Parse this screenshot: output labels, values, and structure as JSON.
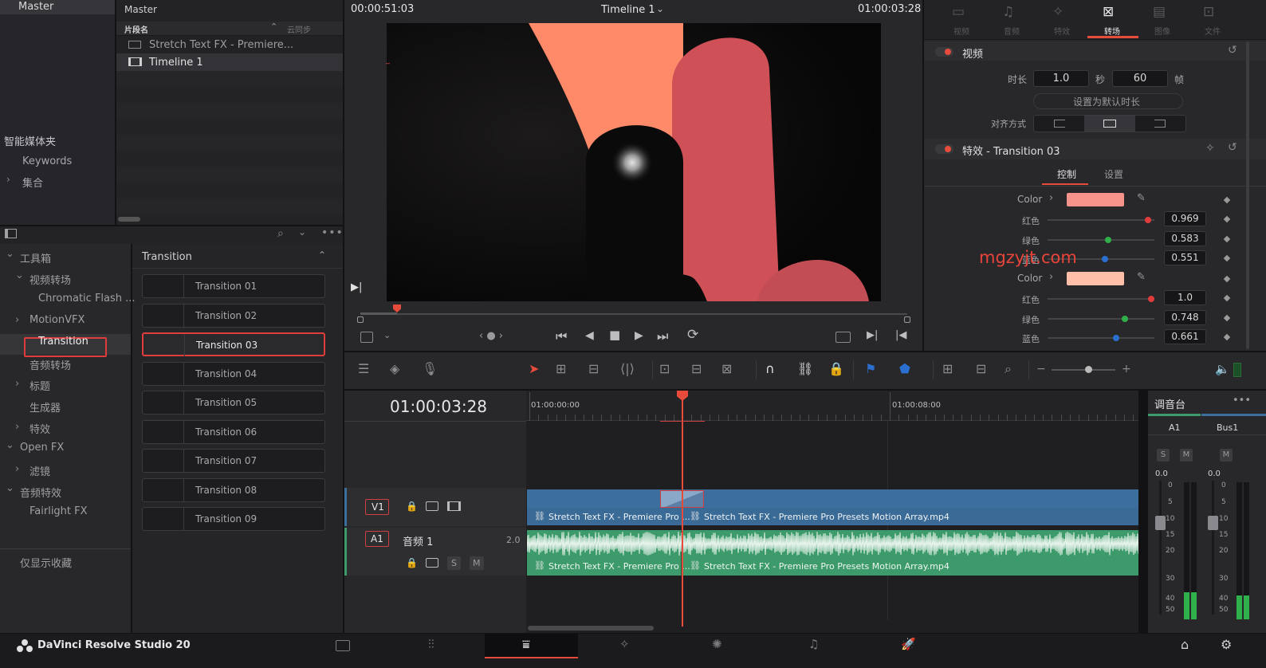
{
  "media_pool": {
    "left_header": "Master",
    "header": "Master",
    "col_clip_name": "片段名",
    "col_sync": "云同步",
    "items": [
      {
        "name": "Stretch Text FX - Premiere..."
      },
      {
        "name": "Timeline 1"
      }
    ],
    "smart_bins_title": "智能媒体夹",
    "smart_bins": [
      "Keywords",
      "集合"
    ]
  },
  "effects": {
    "tree": [
      {
        "label": "工具箱",
        "arrow": "⌄"
      },
      {
        "label": "视频转场",
        "arrow": "⌄"
      },
      {
        "label": "Chromatic Flash ...",
        "arrow": ""
      },
      {
        "label": "MotionVFX",
        "arrow": "›"
      },
      {
        "label": "Transition",
        "arrow": ""
      },
      {
        "label": "音频转场",
        "arrow": ""
      },
      {
        "label": "标题",
        "arrow": "›"
      },
      {
        "label": "生成器",
        "arrow": ""
      },
      {
        "label": "特效",
        "arrow": "›"
      },
      {
        "label": "Open FX",
        "arrow": "⌄"
      },
      {
        "label": "滤镜",
        "arrow": "›"
      },
      {
        "label": "音频特效",
        "arrow": "⌄"
      },
      {
        "label": "Fairlight FX",
        "arrow": ""
      }
    ],
    "favorites_label": "仅显示收藏",
    "list_title": "Transition",
    "list": [
      "Transition 01",
      "Transition 02",
      "Transition 03",
      "Transition 04",
      "Transition 05",
      "Transition 06",
      "Transition 07",
      "Transition 08",
      "Transition 09"
    ],
    "selected": "Transition 03"
  },
  "viewer": {
    "timecode_left": "00:00:51:03",
    "title": "Timeline 1",
    "timecode_right": "01:00:03:28",
    "progress": 0.04
  },
  "inspector": {
    "tabs": [
      "视频",
      "音频",
      "特效",
      "转场",
      "图像",
      "文件"
    ],
    "active_tab": "转场",
    "video_section": "视频",
    "duration_label": "时长",
    "duration_value": "1.0",
    "seconds_label": "秒",
    "frames_value": "60",
    "frames_label": "帧",
    "set_default_label": "设置为默认时长",
    "alignment_label": "对齐方式",
    "effect_section": "特效 - Transition 03",
    "subtabs": [
      "控制",
      "设置"
    ],
    "color1_label": "Color",
    "color1": "#f6948c",
    "red_label": "红色",
    "green_label": "绿色",
    "blue_label": "蓝色",
    "red1": "0.969",
    "green1": "0.583",
    "blue1": "0.551",
    "color2_label": "Color",
    "color2": "#ffbfa8",
    "red2": "1.0",
    "green2": "0.748",
    "blue2": "0.661",
    "watermark": "mgzyjt.com"
  },
  "timeline": {
    "timecode": "01:00:03:28",
    "ruler_start": "01:00:00:00",
    "ruler_mid": "01:00:08:00",
    "v1_label": "V1",
    "a1_label": "A1",
    "audio_track_name": "音频 1",
    "audio_channels": "2.0",
    "clip_short": "Stretch Text FX - Premiere Pro ...",
    "clip_full": "Stretch Text FX - Premiere Pro Presets Motion Array.mp4",
    "solo": "S",
    "mute": "M"
  },
  "mixer": {
    "title": "调音台",
    "channels": [
      "A1",
      "Bus1"
    ],
    "level_a1": "0.0",
    "level_bus": "0.0",
    "scale": [
      "0",
      "5",
      "10",
      "15",
      "20",
      "30",
      "40",
      "50"
    ]
  },
  "bottom_bar": {
    "app_name": "DaVinci Resolve Studio 20"
  },
  "colors": {
    "accent_red": "#e64b3c",
    "video_clip": "#3d6f9e",
    "audio_clip": "#3d9a6a",
    "selection_red": "#e03c3c"
  }
}
